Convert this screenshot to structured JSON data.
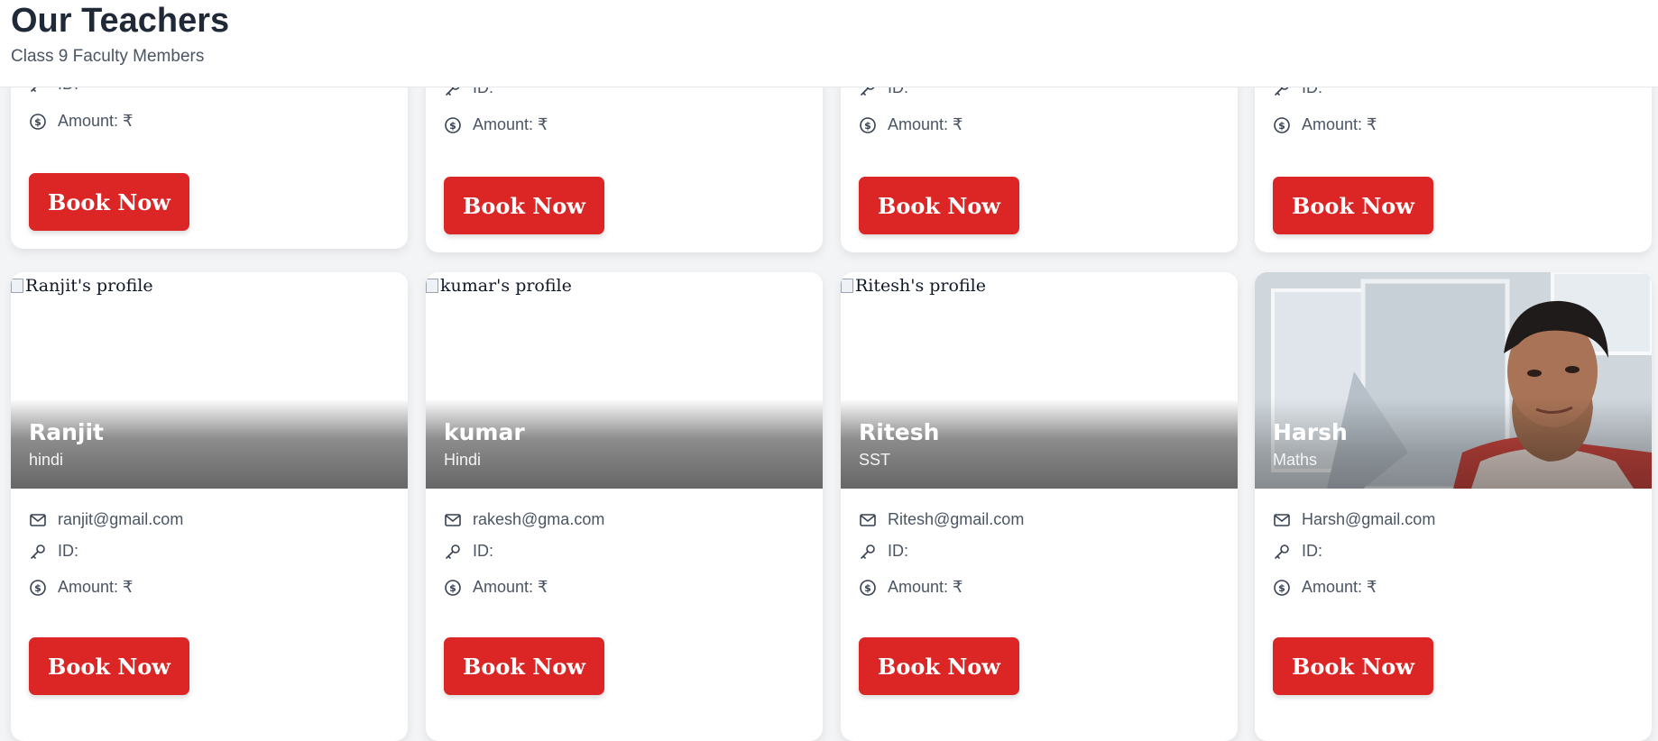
{
  "header": {
    "title": "Our Teachers",
    "subtitle": "Class 9 Faculty Members"
  },
  "labels": {
    "id": "ID:",
    "amount": "Amount: ₹",
    "book": "Book Now"
  },
  "teachers": [
    {
      "name": "Ranjit",
      "subject": "hindi",
      "email": "ranjit@gmail.com",
      "photo_alt": "Ranjit's profile"
    },
    {
      "name": "kumar",
      "subject": "Hindi",
      "email": "rakesh@gma.com",
      "photo_alt": "kumar's profile"
    },
    {
      "name": "Ritesh",
      "subject": "SST",
      "email": "Ritesh@gmail.com",
      "photo_alt": "Ritesh's profile"
    },
    {
      "name": "Harsh",
      "subject": "Maths",
      "email": "Harsh@gmail.com",
      "photo_alt": "Harsh's profile"
    }
  ],
  "colors": {
    "accent": "#dc2626",
    "title": "#1f2937",
    "muted": "#4b5563"
  },
  "icons": [
    "mail-icon",
    "key-icon",
    "dollar-circle-icon",
    "broken-image-icon"
  ]
}
